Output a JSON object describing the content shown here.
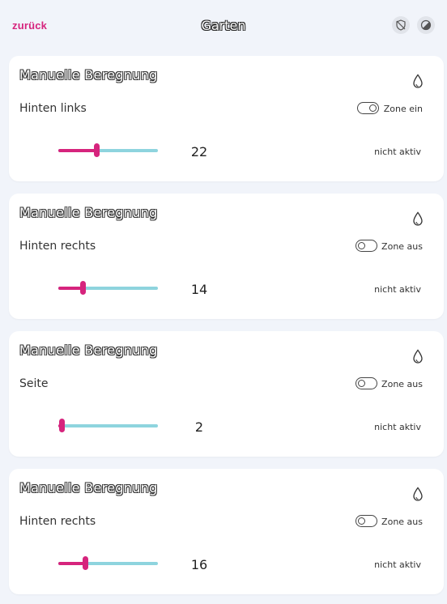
{
  "header": {
    "back_label": "zurück",
    "title": "Garten",
    "icons": [
      "shield-off-icon",
      "contrast-icon"
    ]
  },
  "colors": {
    "accent": "#d6247d",
    "track": "#8ed4de",
    "background": "#f1f4fa"
  },
  "cards": [
    {
      "title": "Manuelle Beregnung",
      "zone": "Hinten links",
      "toggle_on": true,
      "zone_state": "Zone ein",
      "value": 22,
      "slider_fraction": 0.38,
      "status": "nicht aktiv"
    },
    {
      "title": "Manuelle Beregnung",
      "zone": "Hinten rechts",
      "toggle_on": false,
      "zone_state": "Zone aus",
      "value": 14,
      "slider_fraction": 0.24,
      "status": "nicht aktiv"
    },
    {
      "title": "Manuelle Beregnung",
      "zone": "Seite",
      "toggle_on": false,
      "zone_state": "Zone aus",
      "value": 2,
      "slider_fraction": 0.03,
      "status": "nicht aktiv"
    },
    {
      "title": "Manuelle Beregnung",
      "zone": "Hinten rechts",
      "toggle_on": false,
      "zone_state": "Zone aus",
      "value": 16,
      "slider_fraction": 0.27,
      "status": "nicht aktiv"
    }
  ]
}
